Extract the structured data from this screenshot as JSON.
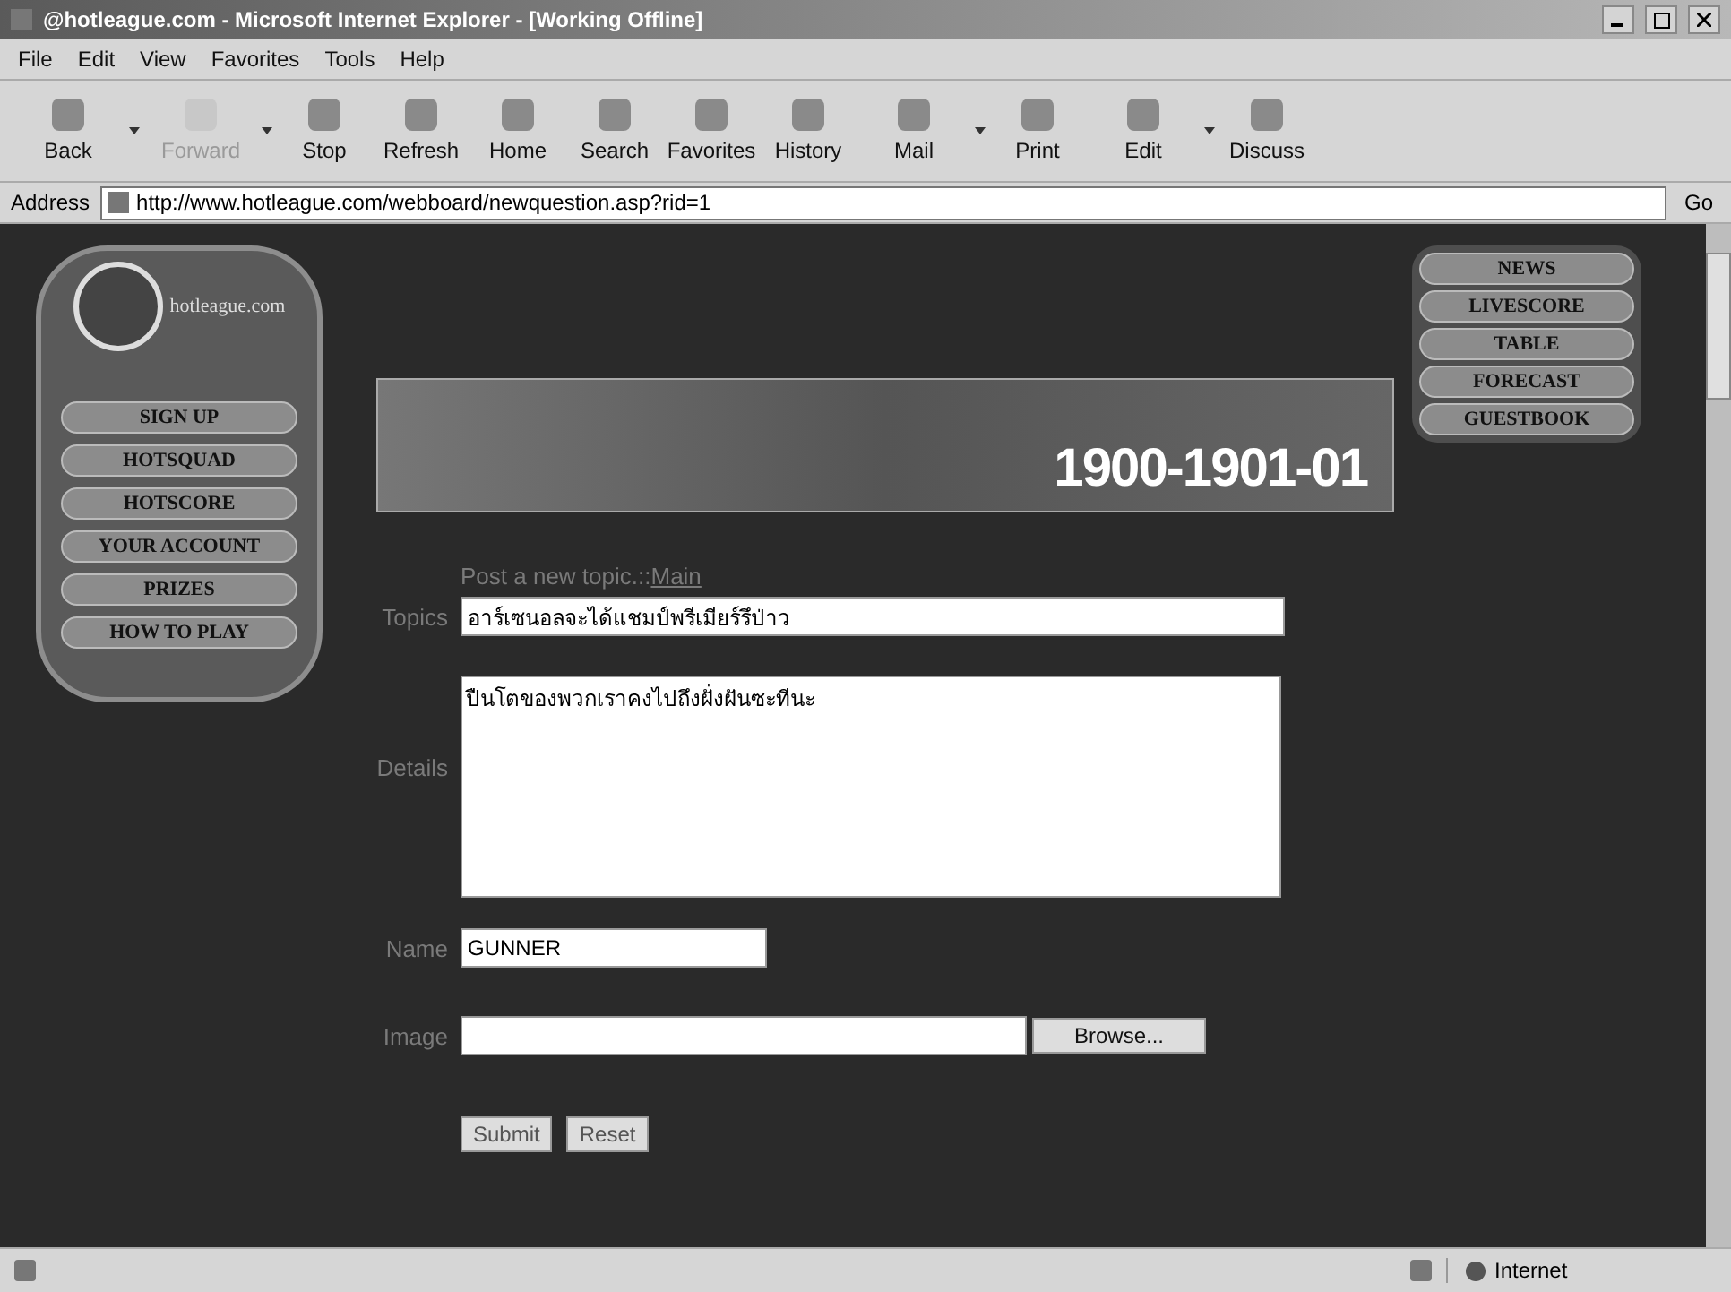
{
  "window": {
    "title": "@hotleague.com - Microsoft Internet Explorer - [Working Offline]"
  },
  "menu": [
    {
      "label": "File"
    },
    {
      "label": "Edit"
    },
    {
      "label": "View"
    },
    {
      "label": "Favorites"
    },
    {
      "label": "Tools"
    },
    {
      "label": "Help"
    }
  ],
  "toolbar": [
    {
      "label": "Back",
      "disabled": false,
      "dropdown": true
    },
    {
      "label": "Forward",
      "disabled": true,
      "dropdown": true
    },
    {
      "label": "Stop",
      "disabled": false,
      "dropdown": false
    },
    {
      "label": "Refresh",
      "disabled": false,
      "dropdown": false
    },
    {
      "label": "Home",
      "disabled": false,
      "dropdown": false
    },
    {
      "label": "Search",
      "disabled": false,
      "dropdown": false
    },
    {
      "label": "Favorites",
      "disabled": false,
      "dropdown": false
    },
    {
      "label": "History",
      "disabled": false,
      "dropdown": false
    },
    {
      "label": "Mail",
      "disabled": false,
      "dropdown": true
    },
    {
      "label": "Print",
      "disabled": false,
      "dropdown": false
    },
    {
      "label": "Edit",
      "disabled": false,
      "dropdown": true
    },
    {
      "label": "Discuss",
      "disabled": false,
      "dropdown": false
    }
  ],
  "address": {
    "label": "Address",
    "url": "http://www.hotleague.com/webboard/newquestion.asp?rid=1",
    "go": "Go"
  },
  "site": {
    "logo": "hotleague.com",
    "left_nav": [
      "SIGN UP",
      "HOTSQUAD",
      "HOTSCORE",
      "YOUR ACCOUNT",
      "PRIZES",
      "HOW TO PLAY"
    ],
    "banner_text": "1900-1901-01",
    "right_nav": [
      "NEWS",
      "LIVESCORE",
      "TABLE",
      "FORECAST",
      "GUESTBOOK"
    ]
  },
  "form": {
    "heading": "Post a new topic.::",
    "heading_link": "Main",
    "topics": {
      "label": "Topics",
      "value": "อาร์เซนอลจะได้แชมป์พรีเมียร์รึป่าว"
    },
    "details": {
      "label": "Details",
      "value": "ปืนโตของพวกเราคงไปถึงฝั่งฝันซะทีนะ"
    },
    "name": {
      "label": "Name",
      "value": "GUNNER"
    },
    "image": {
      "label": "Image",
      "button": "Browse..."
    },
    "buttons": [
      "Submit",
      "Reset"
    ]
  },
  "status_bar": {
    "zone": "Internet"
  }
}
